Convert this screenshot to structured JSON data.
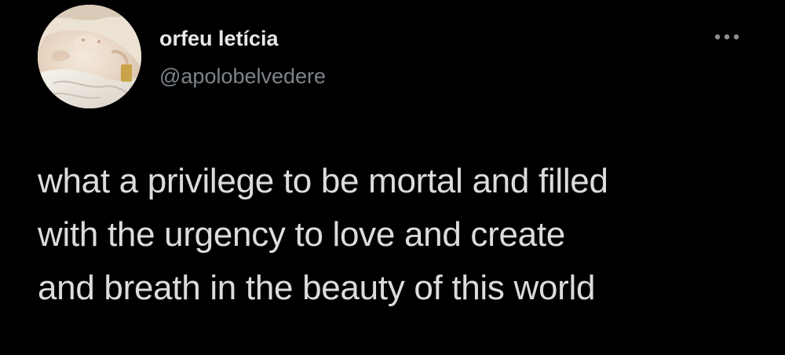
{
  "author": {
    "display_name": "orfeu letícia",
    "handle": "@apolobelvedere",
    "avatar_icon": "classical-painting-avatar"
  },
  "more_icon": "more-horizontal-icon",
  "tweet": {
    "lines": [
      "what a privilege to be mortal and filled",
      "with the urgency to love and create",
      "and breath in the beauty of this world"
    ]
  },
  "colors": {
    "background": "#000000",
    "display_name": "#e7e7e7",
    "handle": "#7d838a",
    "body_text": "#dcdcdc",
    "icon": "#8a8f94"
  }
}
